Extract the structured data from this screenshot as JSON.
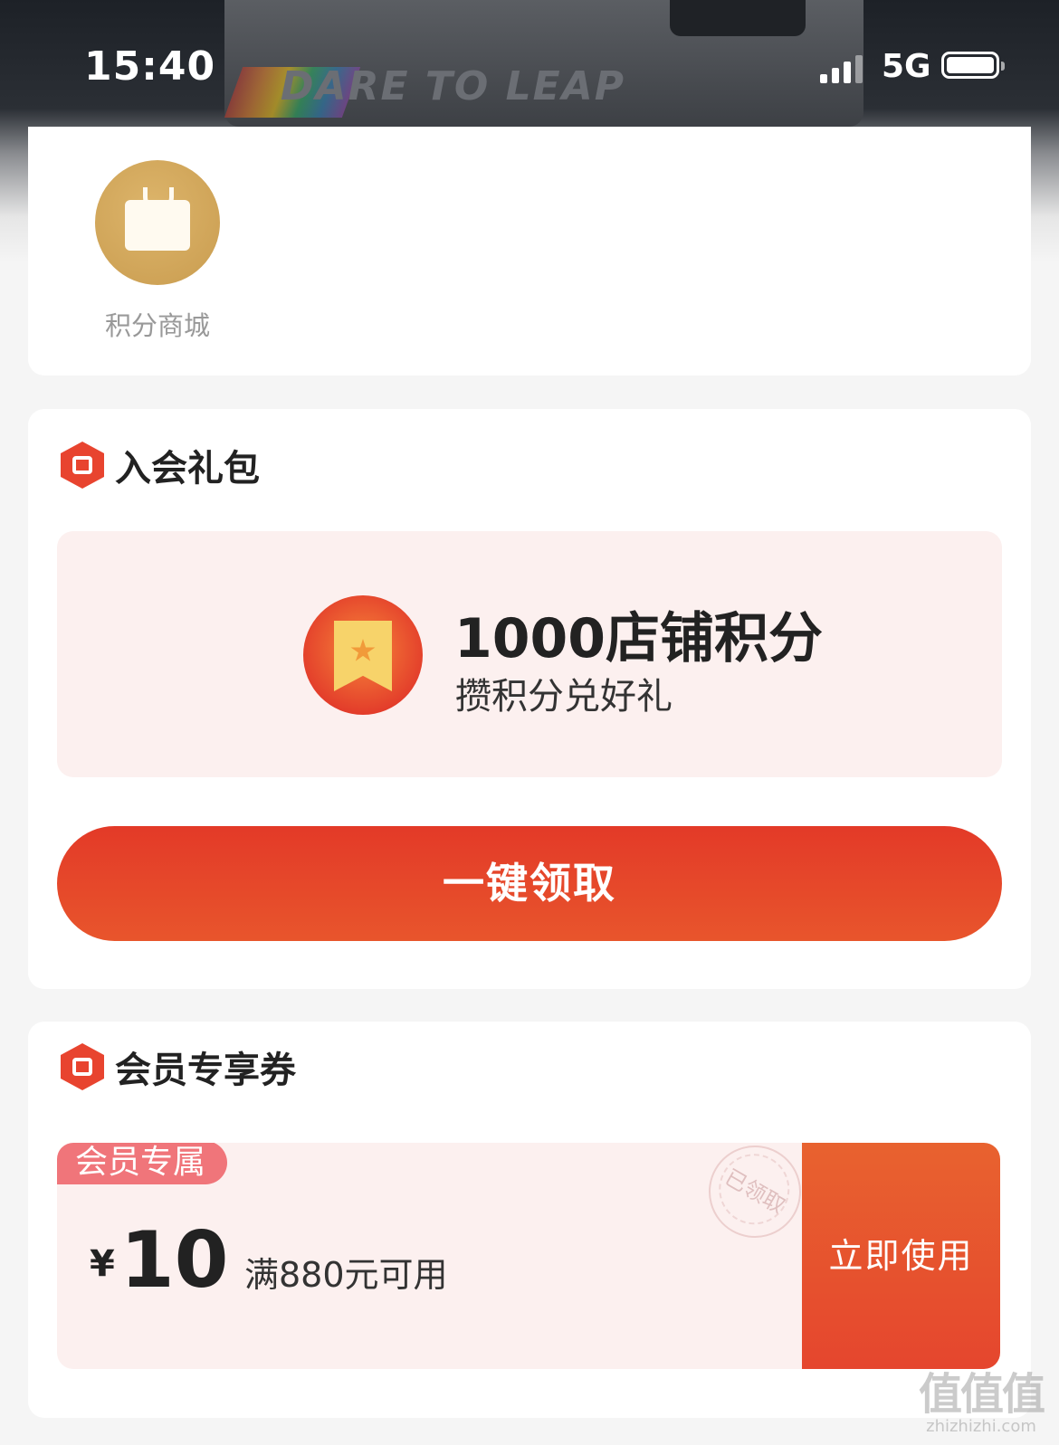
{
  "status_bar": {
    "time": "15:40",
    "network": "5G",
    "battery": "full"
  },
  "hero": {
    "slogan": "DARE TO LEAP"
  },
  "mall": {
    "label": "积分商城",
    "icon": "shopping-bag-icon"
  },
  "gift_section": {
    "title": "入会礼包",
    "icon": "ticket-icon",
    "reward": {
      "amount": "1000店铺积分",
      "subtitle": "攒积分兑好礼",
      "icon": "bookmark-star-icon"
    },
    "claim_button": "一键领取"
  },
  "coupon_section": {
    "title": "会员专享券",
    "icon": "ticket-icon",
    "coupon": {
      "tag": "会员专属",
      "currency": "¥",
      "amount": "10",
      "condition": "满880元可用",
      "stamp": "已领取",
      "use_button": "立即使用"
    }
  },
  "watermark": {
    "logo": "值值值",
    "url": "zhizhizhi.com"
  },
  "colors": {
    "accent_red": "#e33a28",
    "coupon_bg": "#fcf0ef",
    "gold": "#d4aa5e",
    "tag_pink": "#f0757a",
    "page_bg": "#f5f5f5"
  }
}
